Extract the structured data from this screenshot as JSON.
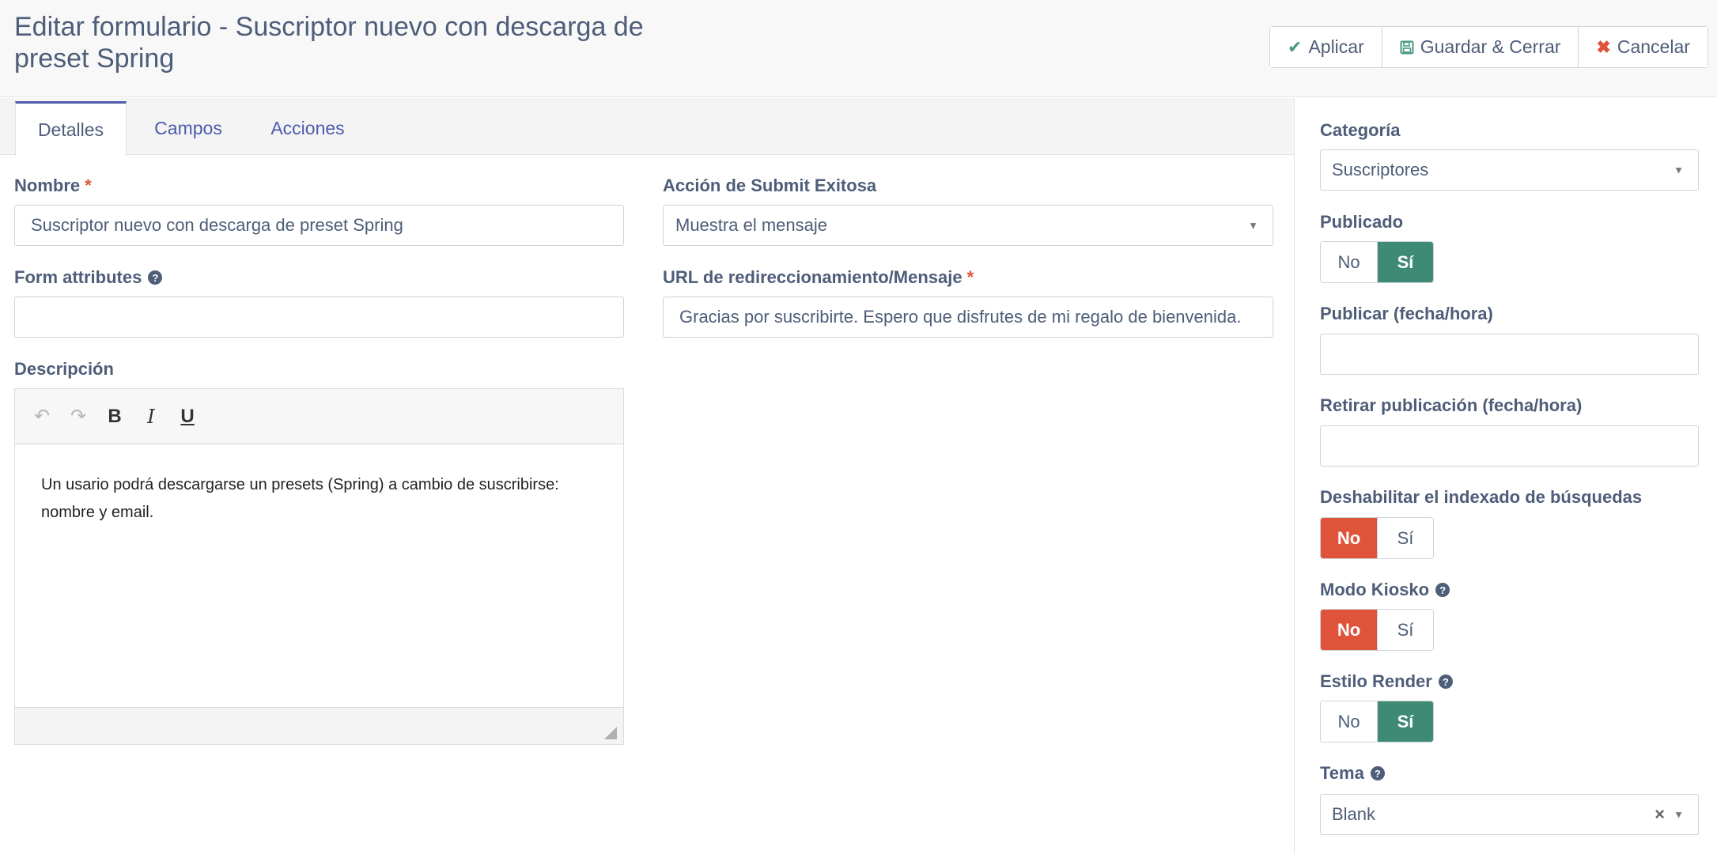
{
  "header": {
    "title": "Editar formulario - Suscriptor nuevo con descarga de preset Spring",
    "buttons": {
      "apply": "Aplicar",
      "save_close": "Guardar & Cerrar",
      "cancel": "Cancelar"
    }
  },
  "tabs": [
    {
      "label": "Detalles",
      "active": true
    },
    {
      "label": "Campos",
      "active": false
    },
    {
      "label": "Acciones",
      "active": false
    }
  ],
  "main": {
    "name": {
      "label": "Nombre",
      "required_mark": "*",
      "value": "Suscriptor nuevo con descarga de preset Spring"
    },
    "form_attributes": {
      "label": "Form attributes",
      "value": ""
    },
    "description": {
      "label": "Descripción",
      "content": "Un usario podrá descargarse un presets (Spring) a cambio de suscribirse: nombre y email."
    },
    "submit_action": {
      "label": "Acción de Submit Exitosa",
      "value": "Muestra el mensaje"
    },
    "redirect_message": {
      "label": "URL de redireccionamiento/Mensaje",
      "required_mark": "*",
      "value": "Gracias por suscribirte. Espero que disfrutes de mi regalo de bienvenida."
    }
  },
  "sidebar": {
    "category": {
      "label": "Categoría",
      "value": "Suscriptores"
    },
    "published": {
      "label": "Publicado",
      "no": "No",
      "yes": "Sí",
      "selected": "yes"
    },
    "publish_up": {
      "label": "Publicar (fecha/hora)",
      "value": ""
    },
    "publish_down": {
      "label": "Retirar publicación (fecha/hora)",
      "value": ""
    },
    "no_index": {
      "label": "Deshabilitar el indexado de búsquedas",
      "no": "No",
      "yes": "Sí",
      "selected": "no"
    },
    "kiosk_mode": {
      "label": "Modo Kiosko",
      "no": "No",
      "yes": "Sí",
      "selected": "no"
    },
    "render_style": {
      "label": "Estilo Render",
      "no": "No",
      "yes": "Sí",
      "selected": "yes"
    },
    "theme": {
      "label": "Tema",
      "value": "Blank"
    }
  },
  "colors": {
    "accent_blue": "#4c5cab",
    "green": "#3e8a74",
    "red": "#e0533b"
  }
}
